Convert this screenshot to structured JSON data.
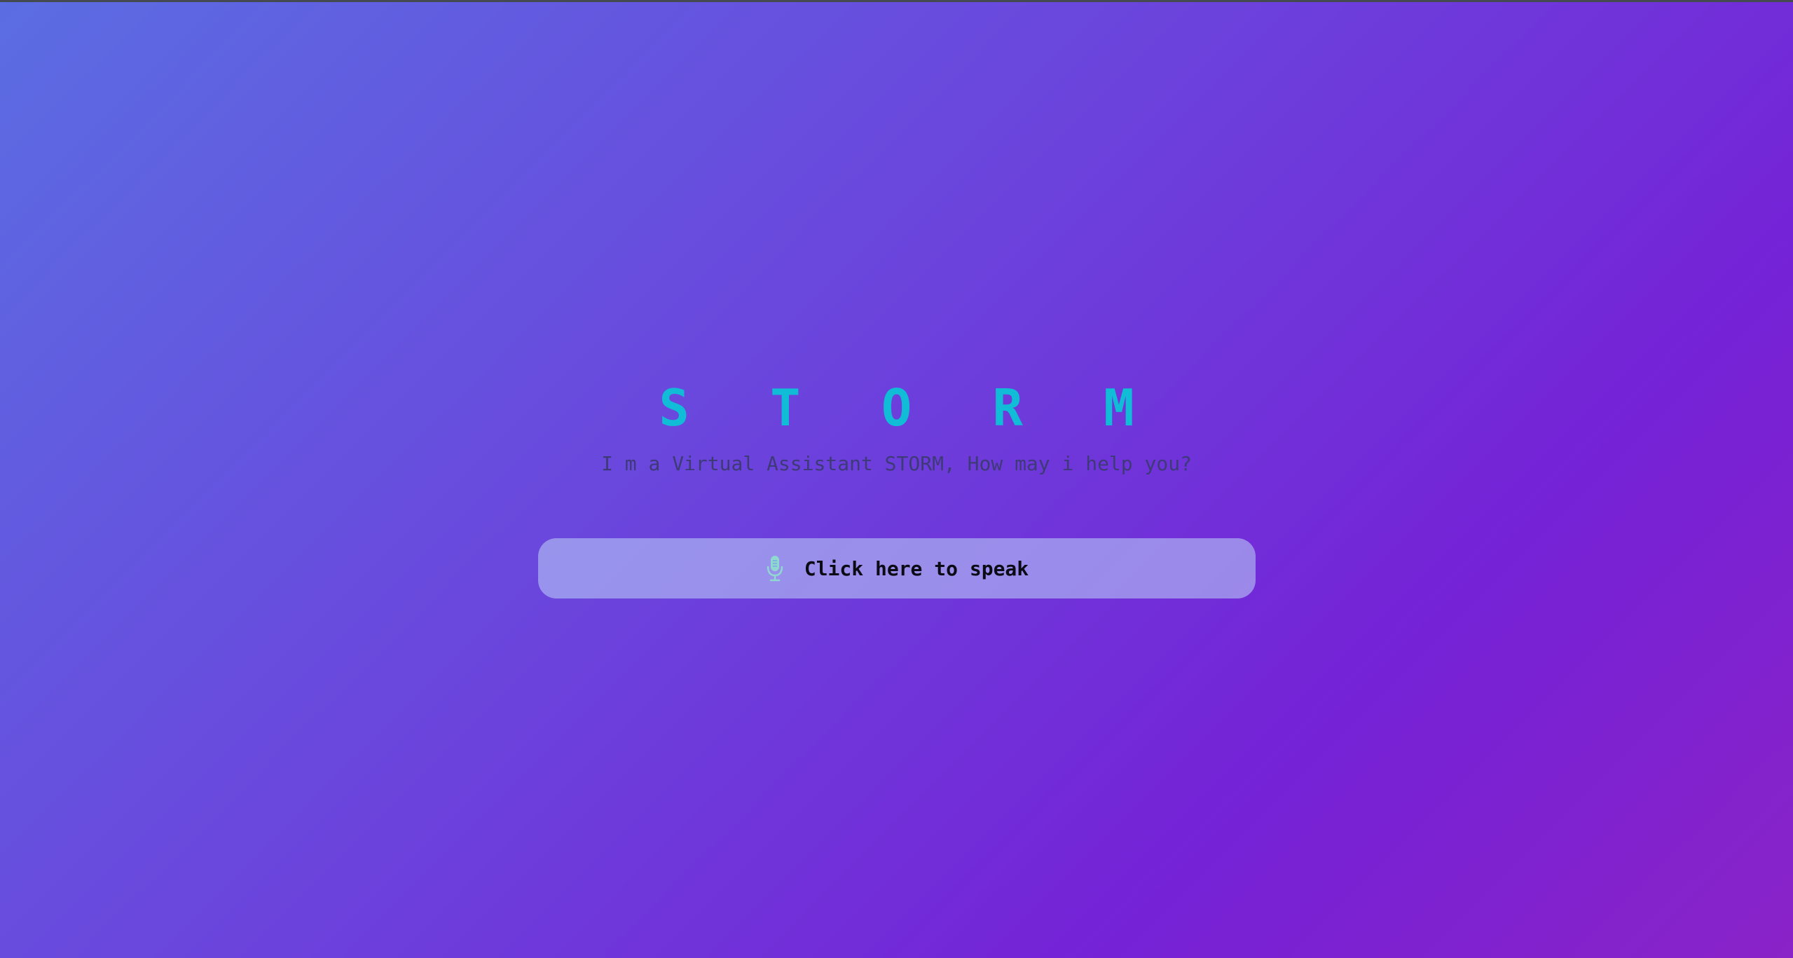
{
  "app": {
    "title": "S T O R M",
    "subtitle": "I m a Virtual Assistant STORM, How may i help you?"
  },
  "speak_button": {
    "label": "Click here to speak",
    "icon": "microphone-icon"
  },
  "colors": {
    "title": "#10bcd6",
    "subtitle": "#3e3a78",
    "gradient_start": "#5b6de2",
    "gradient_end": "#8a23c8",
    "button_bg": "#b4c4f5",
    "mic_icon": "#8fd8d0"
  }
}
